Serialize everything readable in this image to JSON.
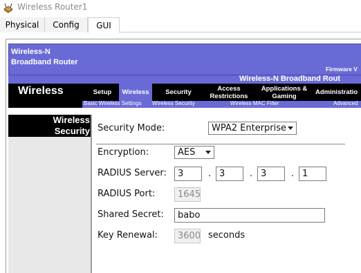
{
  "window": {
    "title": "Wireless Router1",
    "icon": "router-icon"
  },
  "tabs": [
    {
      "label": "Physical"
    },
    {
      "label": "Config"
    },
    {
      "label": "GUI"
    }
  ],
  "router": {
    "product_line1": "Wireless-N",
    "product_line2": "Broadband Router",
    "firmware": "Firmware V",
    "model_name": "Wireless-N Broadband Rout",
    "section_title": "Wireless",
    "nav": [
      {
        "label": "Setup"
      },
      {
        "label": "Wireless"
      },
      {
        "label": "Security"
      },
      {
        "label": "Access Restrictions"
      },
      {
        "label": "Applications & Gaming"
      },
      {
        "label": "Administratio"
      }
    ],
    "subnav": [
      {
        "label": "Basic Wireless Settings"
      },
      {
        "label": "Wireless Security"
      },
      {
        "label": "Wireless MAC Filter"
      },
      {
        "label": "Advanced"
      }
    ],
    "left_title_line1": "Wireless",
    "left_title_line2": "Security"
  },
  "form": {
    "security_mode_label": "Security Mode:",
    "security_mode_value": "WPA2 Enterprise",
    "encryption_label": "Encryption:",
    "encryption_value": "AES",
    "radius_server_label": "RADIUS Server:",
    "radius_server": [
      "3",
      "3",
      "3",
      "1"
    ],
    "dot": ".",
    "radius_port_label": "RADIUS Port:",
    "radius_port_value": "1645",
    "shared_secret_label": "Shared Secret:",
    "shared_secret_value": "babo",
    "key_renewal_label": "Key Renewal:",
    "key_renewal_value": "3600",
    "key_renewal_unit": "seconds"
  },
  "colors": {
    "accent_purple": "#6a6ad6",
    "nav_black": "#000000"
  }
}
